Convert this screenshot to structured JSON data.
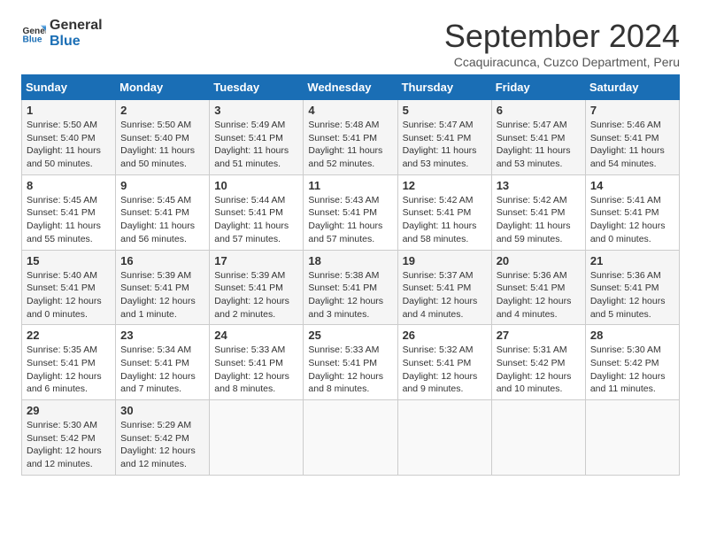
{
  "logo": {
    "line1": "General",
    "line2": "Blue"
  },
  "title": "September 2024",
  "subtitle": "Ccaquiracunca, Cuzco Department, Peru",
  "headers": [
    "Sunday",
    "Monday",
    "Tuesday",
    "Wednesday",
    "Thursday",
    "Friday",
    "Saturday"
  ],
  "weeks": [
    [
      {
        "day": "1",
        "info": "Sunrise: 5:50 AM\nSunset: 5:40 PM\nDaylight: 11 hours\nand 50 minutes."
      },
      {
        "day": "2",
        "info": "Sunrise: 5:50 AM\nSunset: 5:40 PM\nDaylight: 11 hours\nand 50 minutes."
      },
      {
        "day": "3",
        "info": "Sunrise: 5:49 AM\nSunset: 5:41 PM\nDaylight: 11 hours\nand 51 minutes."
      },
      {
        "day": "4",
        "info": "Sunrise: 5:48 AM\nSunset: 5:41 PM\nDaylight: 11 hours\nand 52 minutes."
      },
      {
        "day": "5",
        "info": "Sunrise: 5:47 AM\nSunset: 5:41 PM\nDaylight: 11 hours\nand 53 minutes."
      },
      {
        "day": "6",
        "info": "Sunrise: 5:47 AM\nSunset: 5:41 PM\nDaylight: 11 hours\nand 53 minutes."
      },
      {
        "day": "7",
        "info": "Sunrise: 5:46 AM\nSunset: 5:41 PM\nDaylight: 11 hours\nand 54 minutes."
      }
    ],
    [
      {
        "day": "8",
        "info": "Sunrise: 5:45 AM\nSunset: 5:41 PM\nDaylight: 11 hours\nand 55 minutes."
      },
      {
        "day": "9",
        "info": "Sunrise: 5:45 AM\nSunset: 5:41 PM\nDaylight: 11 hours\nand 56 minutes."
      },
      {
        "day": "10",
        "info": "Sunrise: 5:44 AM\nSunset: 5:41 PM\nDaylight: 11 hours\nand 57 minutes."
      },
      {
        "day": "11",
        "info": "Sunrise: 5:43 AM\nSunset: 5:41 PM\nDaylight: 11 hours\nand 57 minutes."
      },
      {
        "day": "12",
        "info": "Sunrise: 5:42 AM\nSunset: 5:41 PM\nDaylight: 11 hours\nand 58 minutes."
      },
      {
        "day": "13",
        "info": "Sunrise: 5:42 AM\nSunset: 5:41 PM\nDaylight: 11 hours\nand 59 minutes."
      },
      {
        "day": "14",
        "info": "Sunrise: 5:41 AM\nSunset: 5:41 PM\nDaylight: 12 hours\nand 0 minutes."
      }
    ],
    [
      {
        "day": "15",
        "info": "Sunrise: 5:40 AM\nSunset: 5:41 PM\nDaylight: 12 hours\nand 0 minutes."
      },
      {
        "day": "16",
        "info": "Sunrise: 5:39 AM\nSunset: 5:41 PM\nDaylight: 12 hours\nand 1 minute."
      },
      {
        "day": "17",
        "info": "Sunrise: 5:39 AM\nSunset: 5:41 PM\nDaylight: 12 hours\nand 2 minutes."
      },
      {
        "day": "18",
        "info": "Sunrise: 5:38 AM\nSunset: 5:41 PM\nDaylight: 12 hours\nand 3 minutes."
      },
      {
        "day": "19",
        "info": "Sunrise: 5:37 AM\nSunset: 5:41 PM\nDaylight: 12 hours\nand 4 minutes."
      },
      {
        "day": "20",
        "info": "Sunrise: 5:36 AM\nSunset: 5:41 PM\nDaylight: 12 hours\nand 4 minutes."
      },
      {
        "day": "21",
        "info": "Sunrise: 5:36 AM\nSunset: 5:41 PM\nDaylight: 12 hours\nand 5 minutes."
      }
    ],
    [
      {
        "day": "22",
        "info": "Sunrise: 5:35 AM\nSunset: 5:41 PM\nDaylight: 12 hours\nand 6 minutes."
      },
      {
        "day": "23",
        "info": "Sunrise: 5:34 AM\nSunset: 5:41 PM\nDaylight: 12 hours\nand 7 minutes."
      },
      {
        "day": "24",
        "info": "Sunrise: 5:33 AM\nSunset: 5:41 PM\nDaylight: 12 hours\nand 8 minutes."
      },
      {
        "day": "25",
        "info": "Sunrise: 5:33 AM\nSunset: 5:41 PM\nDaylight: 12 hours\nand 8 minutes."
      },
      {
        "day": "26",
        "info": "Sunrise: 5:32 AM\nSunset: 5:41 PM\nDaylight: 12 hours\nand 9 minutes."
      },
      {
        "day": "27",
        "info": "Sunrise: 5:31 AM\nSunset: 5:42 PM\nDaylight: 12 hours\nand 10 minutes."
      },
      {
        "day": "28",
        "info": "Sunrise: 5:30 AM\nSunset: 5:42 PM\nDaylight: 12 hours\nand 11 minutes."
      }
    ],
    [
      {
        "day": "29",
        "info": "Sunrise: 5:30 AM\nSunset: 5:42 PM\nDaylight: 12 hours\nand 12 minutes."
      },
      {
        "day": "30",
        "info": "Sunrise: 5:29 AM\nSunset: 5:42 PM\nDaylight: 12 hours\nand 12 minutes."
      },
      null,
      null,
      null,
      null,
      null
    ]
  ]
}
